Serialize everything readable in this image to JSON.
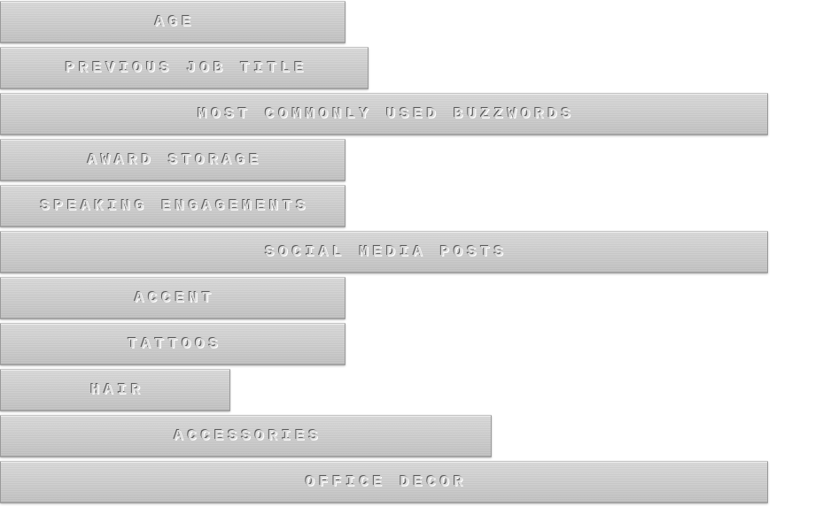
{
  "chart_data": {
    "type": "bar",
    "orientation": "horizontal",
    "categories": [
      "AGE",
      "PREVIOUS JOB TITLE",
      "MOST COMMONLY USED BUZZWORDS",
      "AWARD STORAGE",
      "SPEAKING ENGAGEMENTS",
      "SOCIAL MEDIA POSTS",
      "ACCENT",
      "TATTOOS",
      "HAIR",
      "ACCESSORIES",
      "OFFICE DECOR"
    ],
    "values": [
      45,
      48,
      100,
      45,
      45,
      100,
      45,
      45,
      30,
      64,
      100
    ],
    "xlim": [
      0,
      100
    ],
    "grid": false,
    "axes": "hidden",
    "colors": {
      "bar": "#cfcfcf",
      "label": "#dcdcdc",
      "background": "#ffffff"
    }
  }
}
